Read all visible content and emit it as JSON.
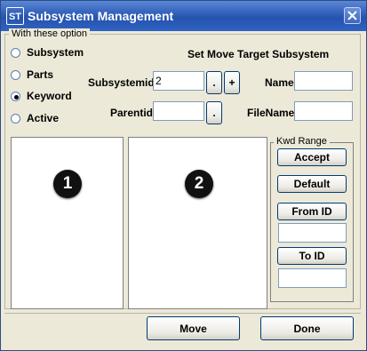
{
  "window": {
    "title": "Subsystem Management",
    "app_icon_text": "ST"
  },
  "group": {
    "legend": "With these option"
  },
  "radios": [
    {
      "label": "Subsystem",
      "checked": false
    },
    {
      "label": "Parts",
      "checked": false
    },
    {
      "label": "Keyword",
      "checked": true
    },
    {
      "label": "Active",
      "checked": false
    }
  ],
  "form": {
    "heading": "Set Move Target Subsystem",
    "subsystemid_label": "Subsystemid",
    "subsystemid_value": "2",
    "dot_button_1": ".",
    "plus_button": "+",
    "parentid_label": "Parentid",
    "parentid_value": "",
    "dot_button_2": ".",
    "name_label": "Name",
    "name_value": "",
    "filename_label": "FileName",
    "filename_value": ""
  },
  "panels": {
    "badge_1": "1",
    "badge_2": "2"
  },
  "kwd": {
    "legend": "Kwd Range",
    "accept": "Accept",
    "default": "Default",
    "from_id": "From ID",
    "from_value": "",
    "to_id": "To ID",
    "to_value": ""
  },
  "footer": {
    "move": "Move",
    "done": "Done"
  }
}
